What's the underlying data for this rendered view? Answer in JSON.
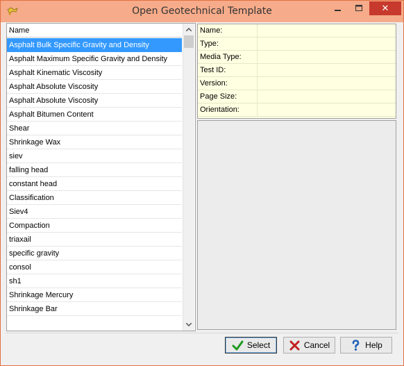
{
  "window": {
    "title": "Open Geotechnical Template",
    "min_icon": "minimize-icon",
    "max_icon": "maximize-icon",
    "close_icon": "close-icon",
    "close_glyph": "✕"
  },
  "list": {
    "header_label": "Name",
    "sort_glyph": "/",
    "selected_index": 0,
    "items": [
      "Asphalt Bulk Specific Gravity and Density",
      "Asphalt Maximum Specific Gravity and Density",
      "Asphalt Kinematic Viscosity",
      "Asphalt Absolute Viscosity",
      "Asphalt Absolute Viscosity",
      "Asphalt Bitumen Content",
      "Shear",
      "Shrinkage Wax",
      "siev",
      "falling head",
      "constant head",
      "Classification",
      "Siev4",
      "Compaction",
      "triaxail",
      "specific gravity",
      "consol",
      "sh1",
      "Shrinkage Mercury",
      "Shrinkage Bar"
    ]
  },
  "properties": {
    "rows": [
      {
        "label": "Name:",
        "value": ""
      },
      {
        "label": "Type:",
        "value": ""
      },
      {
        "label": "Media Type:",
        "value": ""
      },
      {
        "label": "Test ID:",
        "value": ""
      },
      {
        "label": "Version:",
        "value": ""
      },
      {
        "label": "Page Size:",
        "value": ""
      },
      {
        "label": "Orientation:",
        "value": ""
      }
    ]
  },
  "buttons": {
    "select": "Select",
    "cancel": "Cancel",
    "help": "Help"
  },
  "colors": {
    "titlebar": "#f6ab8a",
    "selection": "#3399ff",
    "properties_bg": "#ffffe1",
    "close_button": "#c7392c"
  }
}
